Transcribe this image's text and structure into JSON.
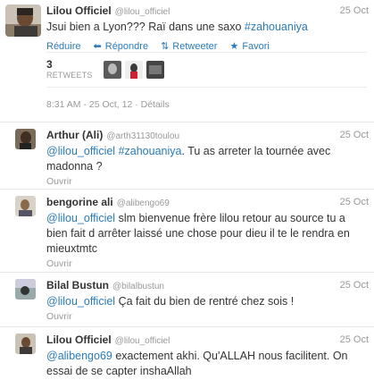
{
  "main_tweet": {
    "name": "Lilou Officiel",
    "handle": "@lilou_officiel",
    "time": "25 Oct",
    "text_plain": "Jsui bien a Lyon??? Raï dans une saxo ",
    "hashtag": "#zahouaniya",
    "actions": {
      "reduce": "Réduire",
      "reply": "Répondre",
      "retweet": "Retweeter",
      "favorite": "Favori"
    },
    "retweet_count": "3",
    "retweet_label": "RETWEETS",
    "meta": "8:31 AM - 25 Oct, 12 · Détails"
  },
  "replies": [
    {
      "name": "Arthur (Ali)",
      "handle": "@arth31130toulou",
      "time": "25 Oct",
      "mention": "@lilou_officiel",
      "hashtag": "#zahouaniya",
      "text_after": ". Tu as arreter la tournée avec madonna ?",
      "open": "Ouvrir"
    },
    {
      "name": "bengorine ali",
      "handle": "@alibengo69",
      "time": "25 Oct",
      "mention": "@lilou_officiel",
      "text_after": " slm bienvenue frère lilou retour au source tu a bien fait d arrêter laissé une chose pour dieu il te le rendra en mieuxtmtc",
      "open": "Ouvrir"
    },
    {
      "name": "Bilal Bustun",
      "handle": "@bilalbustun",
      "time": "25 Oct",
      "mention": "@lilou_officiel",
      "text_after": " Ça fait du bien de rentré chez sois !",
      "open": "Ouvrir"
    },
    {
      "name": "Lilou Officiel",
      "handle": "@lilou_officiel",
      "time": "25 Oct",
      "mention": "@alibengo69",
      "text_after": " exactement akhi. Qu'ALLAH nous facilitent. On essai de se capter inshaAllah",
      "open": ""
    }
  ],
  "icons": {
    "reply": "reply-icon",
    "retweet": "retweet-icon",
    "favorite": "star-icon"
  },
  "colors": {
    "link": "#2a7ab8",
    "muted": "#999999",
    "text": "#333333"
  }
}
